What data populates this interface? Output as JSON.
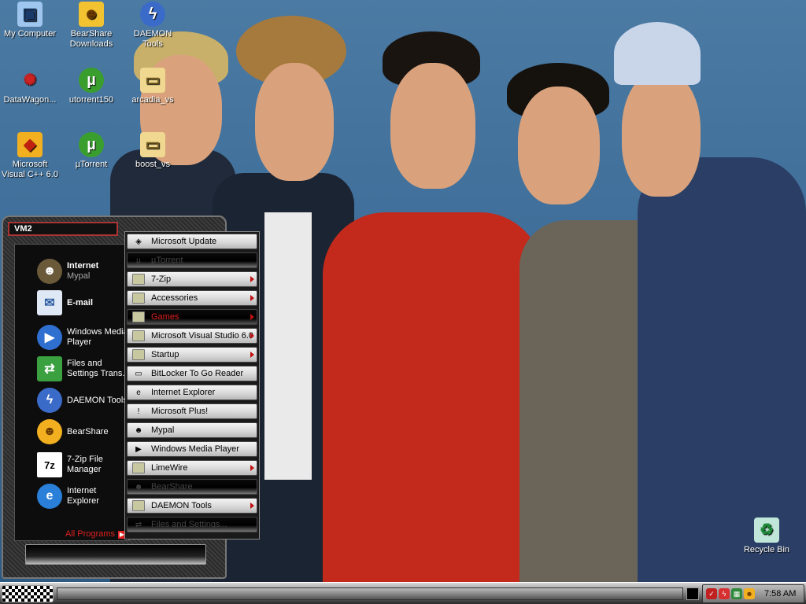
{
  "desktop": {
    "icons": [
      {
        "label": "My Computer",
        "icon": "my-computer-icon",
        "color": "#9fc6ee"
      },
      {
        "label": "BearShare Downloads",
        "icon": "bearshare-downloads-icon",
        "color": "#f2c230"
      },
      {
        "label": "DAEMON Tools",
        "icon": "daemon-tools-icon",
        "color": "#3b6bc9"
      },
      {
        "label": "DataWagon...",
        "icon": "datawagon-icon",
        "color": "#cc2222"
      },
      {
        "label": "utorrent150",
        "icon": "utorrent-icon",
        "color": "#3a9e2e"
      },
      {
        "label": "arcadia_vs",
        "icon": "folder-icon",
        "color": "#f0d890"
      },
      {
        "label": "Microsoft Visual C++ 6.0",
        "icon": "visual-cpp-icon",
        "color": "#d84020"
      },
      {
        "label": "µTorrent",
        "icon": "utorrent-icon",
        "color": "#3a9e2e"
      },
      {
        "label": "boost_vs",
        "icon": "folder-icon",
        "color": "#f0d890"
      }
    ],
    "recycle_bin": {
      "label": "Recycle Bin",
      "icon": "recycle-bin-icon"
    }
  },
  "start_menu": {
    "user": "VM2",
    "pinned": [
      {
        "title": "Internet",
        "subtitle": "Mypal",
        "icon": "mypal-icon",
        "color": "#6b5a3a"
      },
      {
        "title": "E-mail",
        "subtitle": "",
        "icon": "email-icon",
        "color": "#4a86d8"
      }
    ],
    "recent": [
      {
        "label": "Windows Media Player",
        "icon": "windows-media-player-icon",
        "color": "#2f6fd0"
      },
      {
        "label": "Files and Settings Trans...",
        "icon": "files-settings-transfer-icon",
        "color": "#3aa040"
      },
      {
        "label": "DAEMON Tools",
        "icon": "daemon-tools-icon",
        "color": "#3b6bc9"
      },
      {
        "label": "BearShare",
        "icon": "bearshare-icon",
        "color": "#f2b020"
      },
      {
        "label": "7-Zip File Manager",
        "icon": "seven-zip-icon",
        "color": "#ffffff"
      },
      {
        "label": "Internet Explorer",
        "icon": "internet-explorer-icon",
        "color": "#2a7fd8"
      }
    ],
    "all_programs": "All Programs"
  },
  "programs": [
    {
      "label": "Microsoft Update",
      "icon": "microsoft-update-icon",
      "folder": false,
      "style": "normal"
    },
    {
      "label": "µTorrent",
      "icon": "utorrent-icon",
      "folder": false,
      "style": "dark"
    },
    {
      "label": "7-Zip",
      "icon": "folder-icon",
      "folder": true,
      "style": "normal"
    },
    {
      "label": "Accessories",
      "icon": "folder-icon",
      "folder": true,
      "style": "normal"
    },
    {
      "label": "Games",
      "icon": "folder-icon",
      "folder": true,
      "style": "highlight"
    },
    {
      "label": "Microsoft Visual Studio 6.0",
      "icon": "folder-icon",
      "folder": true,
      "style": "normal"
    },
    {
      "label": "Startup",
      "icon": "folder-icon",
      "folder": true,
      "style": "normal"
    },
    {
      "label": "BitLocker To Go Reader",
      "icon": "bitlocker-icon",
      "folder": false,
      "style": "normal"
    },
    {
      "label": "Internet Explorer",
      "icon": "internet-explorer-icon",
      "folder": false,
      "style": "normal"
    },
    {
      "label": "Microsoft Plus!",
      "icon": "microsoft-plus-icon",
      "folder": false,
      "style": "normal"
    },
    {
      "label": "Mypal",
      "icon": "mypal-icon",
      "folder": false,
      "style": "normal"
    },
    {
      "label": "Windows Media Player",
      "icon": "windows-media-player-icon",
      "folder": false,
      "style": "normal"
    },
    {
      "label": "LimeWire",
      "icon": "folder-icon",
      "folder": true,
      "style": "normal"
    },
    {
      "label": "BearShare",
      "icon": "bearshare-icon",
      "folder": false,
      "style": "dark"
    },
    {
      "label": "DAEMON Tools",
      "icon": "folder-icon",
      "folder": true,
      "style": "normal"
    },
    {
      "label": "Files and Settings...",
      "icon": "files-settings-transfer-icon",
      "folder": false,
      "style": "dark"
    }
  ],
  "taskbar": {
    "clock": "7:58 AM",
    "tray_icons": [
      "shield-icon",
      "lightning-icon",
      "network-icon",
      "bearshare-tray-icon"
    ]
  }
}
